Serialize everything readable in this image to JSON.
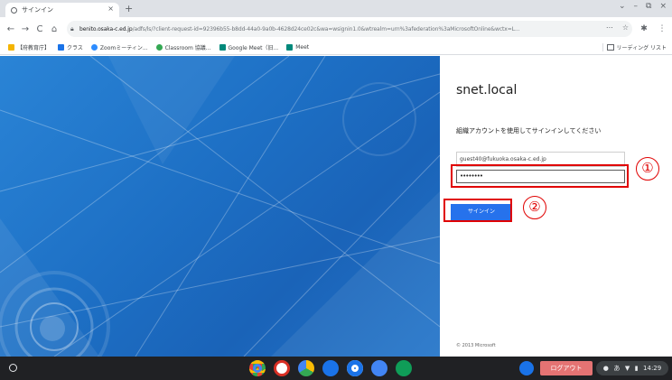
{
  "colors": {
    "accent": "#2672ec",
    "annotation": "#e00000",
    "background_blue": "#1d6fc4",
    "logout": "#e57373"
  },
  "browser": {
    "tab": {
      "title": "サインイン",
      "close": "×",
      "favicon": "globe-icon"
    },
    "new_tab": "+",
    "window_controls": [
      "⌄",
      "–",
      "⧉",
      "×"
    ],
    "nav": {
      "back": "←",
      "forward": "→",
      "reload": "C",
      "home": "⌂"
    },
    "url_host": "benito.osaka-c.ed.jp",
    "url_path": "/adfs/ls/?client-request-id=92396b55-b8dd-44a0-9a0b-4628d24ce02c&wa=wsignin1.0&wtrealm=urn%3afederation%3aMicrosoftOnline&wctx=L...",
    "omnibox_icons": [
      "⋯",
      "☆"
    ],
    "extension_icons": [
      "✱",
      "⋮"
    ],
    "bookmarks": [
      {
        "label": "【府教育庁】",
        "icon_color": "#f4b400"
      },
      {
        "label": "クラス",
        "icon_color": "#1a73e8"
      },
      {
        "label": "Zoomミーティン...",
        "icon_color": "#2d8cff"
      },
      {
        "label": "Classroom 協議...",
        "icon_color": "#34a853"
      },
      {
        "label": "Google Meet（旧...",
        "icon_color": "#00897b"
      },
      {
        "label": "Meet",
        "icon_color": "#00897b"
      }
    ],
    "reading_list": "リーディング リスト"
  },
  "signin": {
    "org_name": "snet.local",
    "instructions": "組織アカウントを使用してサインインしてください",
    "username_value": "guest40@fukuoka.osaka-c.ed.jp",
    "password_value": "••••••••",
    "button_label": "サインイン",
    "copyright": "© 2013 Microsoft"
  },
  "annotations": {
    "marker_1": "①",
    "marker_2": "②"
  },
  "shelf": {
    "apps": [
      {
        "name": "chrome-app-icon",
        "color": "#ea4335"
      },
      {
        "name": "gmail-app-icon",
        "color": "#d93025"
      },
      {
        "name": "drive-app-icon",
        "color": "#fbbc04"
      },
      {
        "name": "files-app-icon",
        "color": "#1a73e8"
      },
      {
        "name": "camera-app-icon",
        "color": "#1a73e8"
      },
      {
        "name": "meet-app-icon",
        "color": "#4285f4"
      },
      {
        "name": "classroom-app-icon",
        "color": "#0f9d58"
      }
    ],
    "logout_label": "ログアウト",
    "status_icons": [
      "●",
      "あ",
      "▼",
      "▮"
    ],
    "time": "14:29"
  }
}
